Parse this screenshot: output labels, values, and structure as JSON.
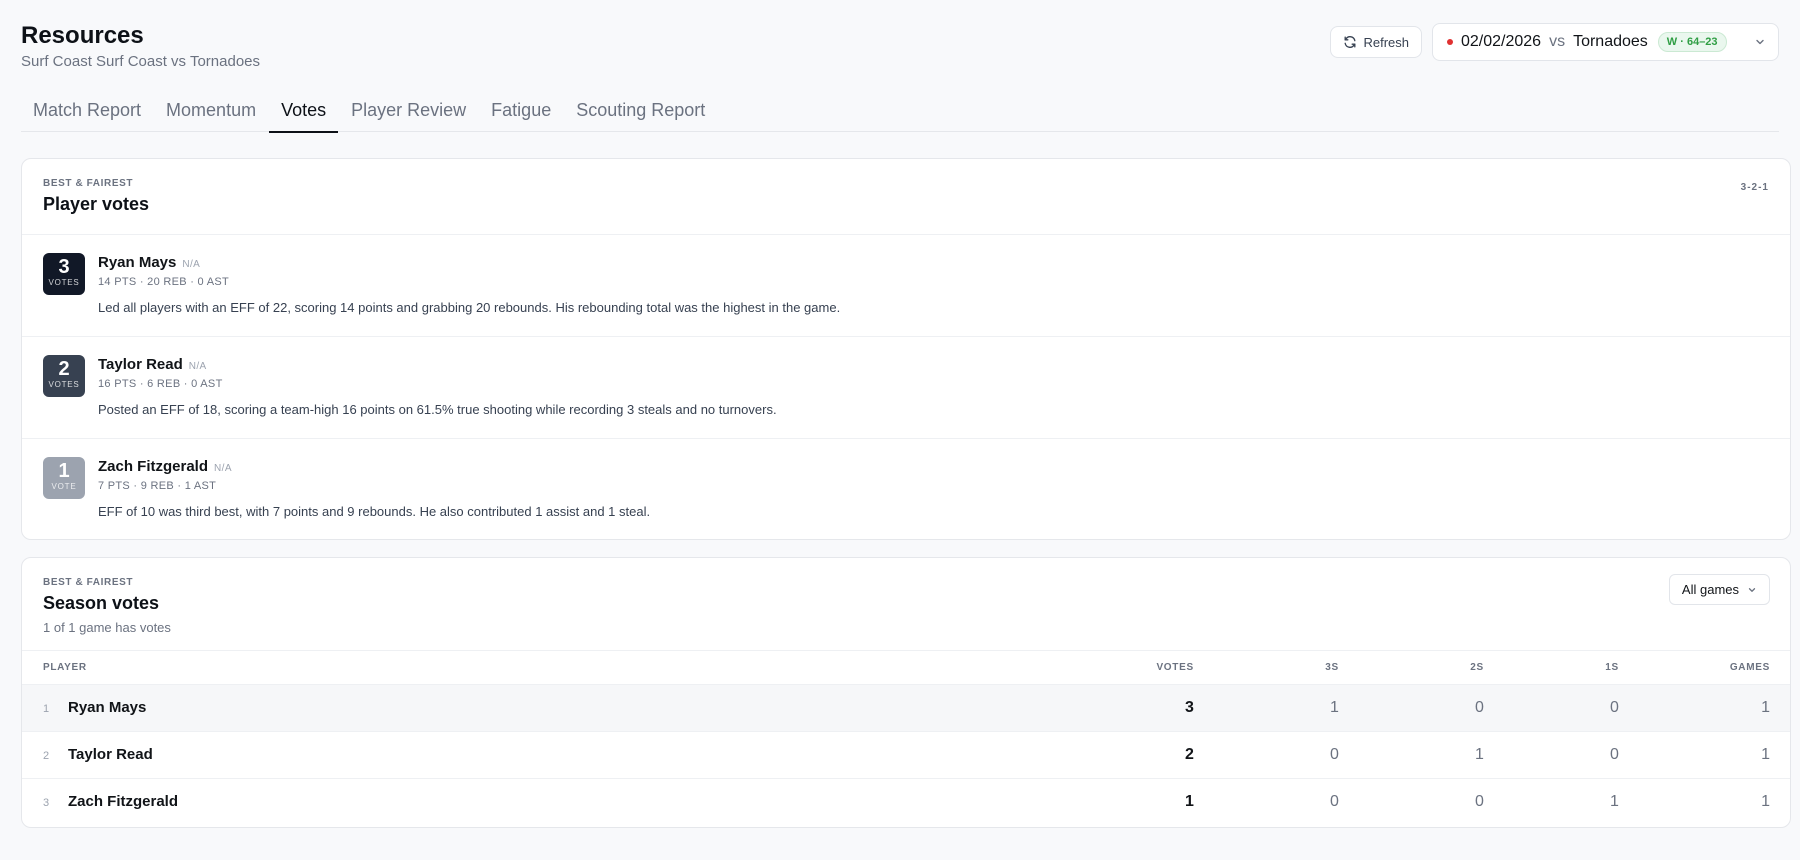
{
  "header": {
    "title": "Resources",
    "subtitle": "Surf Coast Surf Coast vs Tornadoes",
    "refresh_label": "Refresh",
    "game": {
      "date": "02/02/2026",
      "vs": "vs",
      "opponent": "Tornadoes",
      "result": "W · 64–23",
      "dot_color": "#e03131"
    }
  },
  "tabs": [
    {
      "label": "Match Report"
    },
    {
      "label": "Momentum"
    },
    {
      "label": "Votes"
    },
    {
      "label": "Player Review"
    },
    {
      "label": "Fatigue"
    },
    {
      "label": "Scouting Report"
    }
  ],
  "active_tab": "Votes",
  "player_votes": {
    "eyebrow": "BEST & FAIREST",
    "title": "Player votes",
    "scheme": "3-2-1",
    "rows": [
      {
        "votes": "3",
        "unit": "VOTES",
        "name": "Ryan Mays",
        "position": "N/A",
        "stats": "14 PTS · 20 REB · 0 AST",
        "description": "Led all players with an EFF of 22, scoring 14 points and grabbing 20 rebounds. His rebounding total was the highest in the game."
      },
      {
        "votes": "2",
        "unit": "VOTES",
        "name": "Taylor Read",
        "position": "N/A",
        "stats": "16 PTS · 6 REB · 0 AST",
        "description": "Posted an EFF of 18, scoring a team-high 16 points on 61.5% true shooting while recording 3 steals and no turnovers."
      },
      {
        "votes": "1",
        "unit": "VOTE",
        "name": "Zach Fitzgerald",
        "position": "N/A",
        "stats": "7 PTS · 9 REB · 1 AST",
        "description": "EFF of 10 was third best, with 7 points and 9 rebounds. He also contributed 1 assist and 1 steal."
      }
    ]
  },
  "season_votes": {
    "eyebrow": "BEST & FAIREST",
    "title": "Season votes",
    "subtitle": "1 of 1 game has votes",
    "filter_label": "All games",
    "columns": [
      "PLAYER",
      "VOTES",
      "3S",
      "2S",
      "1S",
      "GAMES"
    ],
    "rows": [
      {
        "rank": "1",
        "player": "Ryan Mays",
        "votes": "3",
        "threes": "1",
        "twos": "0",
        "ones": "0",
        "games": "1"
      },
      {
        "rank": "2",
        "player": "Taylor Read",
        "votes": "2",
        "threes": "0",
        "twos": "1",
        "ones": "0",
        "games": "1"
      },
      {
        "rank": "3",
        "player": "Zach Fitzgerald",
        "votes": "1",
        "threes": "0",
        "twos": "0",
        "ones": "1",
        "games": "1"
      }
    ]
  }
}
